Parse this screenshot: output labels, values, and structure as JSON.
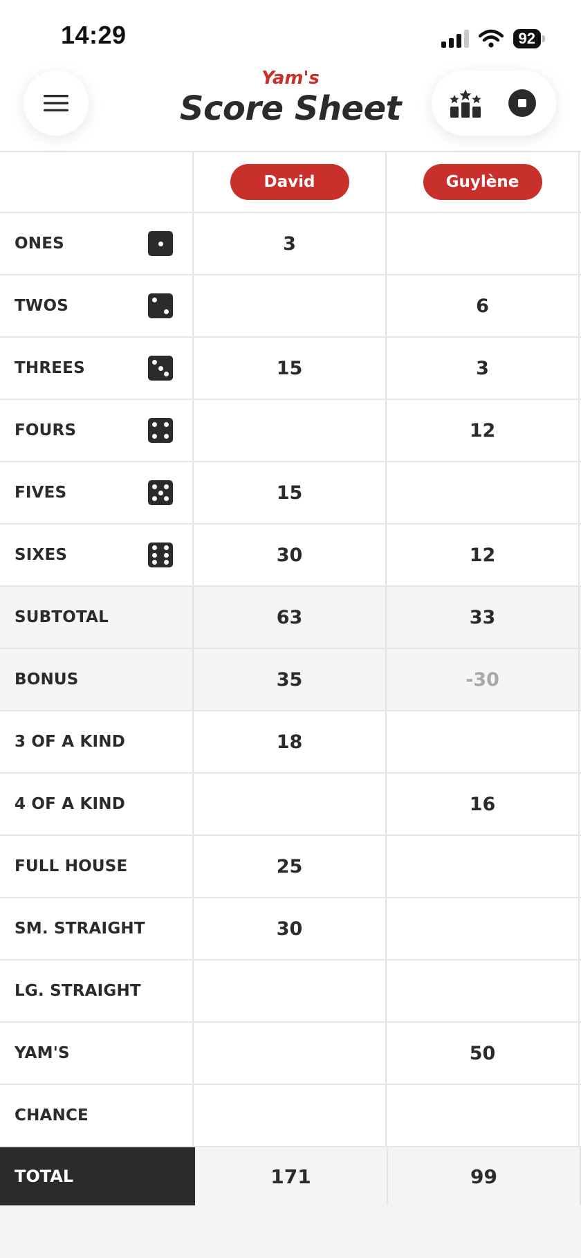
{
  "status_bar": {
    "time": "14:29",
    "battery": "92"
  },
  "header": {
    "subtitle": "Yam's",
    "title": "Score Sheet"
  },
  "players": [
    "David",
    "Guylène"
  ],
  "rows": [
    {
      "label": "ONES",
      "die": "die-one-icon",
      "scores": [
        "3",
        ""
      ]
    },
    {
      "label": "TWOS",
      "die": "die-two-icon",
      "scores": [
        "",
        "6"
      ]
    },
    {
      "label": "THREES",
      "die": "die-three-icon",
      "scores": [
        "15",
        "3"
      ]
    },
    {
      "label": "FOURS",
      "die": "die-four-icon",
      "scores": [
        "",
        "12"
      ]
    },
    {
      "label": "FIVES",
      "die": "die-five-icon",
      "scores": [
        "15",
        ""
      ]
    },
    {
      "label": "SIXES",
      "die": "die-six-icon",
      "scores": [
        "30",
        "12"
      ]
    },
    {
      "label": "SUBTOTAL",
      "scores": [
        "63",
        "33"
      ]
    },
    {
      "label": "BONUS",
      "scores": [
        "35",
        "-30"
      ]
    },
    {
      "label": "3 OF A KIND",
      "scores": [
        "18",
        ""
      ]
    },
    {
      "label": "4 OF A KIND",
      "scores": [
        "",
        "16"
      ]
    },
    {
      "label": "FULL HOUSE",
      "scores": [
        "25",
        ""
      ]
    },
    {
      "label": "SM. STRAIGHT",
      "scores": [
        "30",
        ""
      ]
    },
    {
      "label": "LG. STRAIGHT",
      "scores": [
        "",
        ""
      ]
    },
    {
      "label": "YAM'S",
      "scores": [
        "",
        "50"
      ]
    },
    {
      "label": "CHANCE",
      "scores": [
        "",
        ""
      ]
    }
  ],
  "total": {
    "label": "TOTAL",
    "scores": [
      "171",
      "99"
    ]
  },
  "colors": {
    "accent": "#c9302c",
    "dark": "#2b2b2b",
    "muted": "#a8a8a8"
  }
}
